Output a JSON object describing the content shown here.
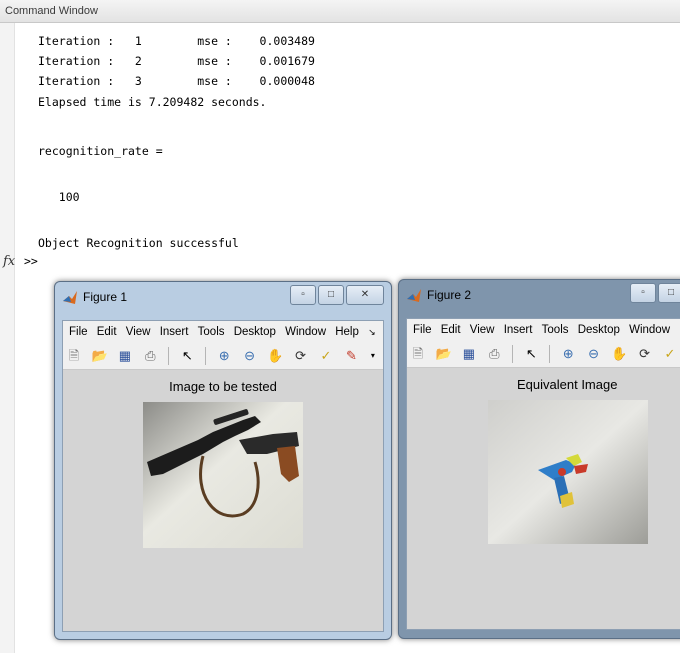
{
  "command_window": {
    "title": "Command Window",
    "lines": [
      "Iteration :   1        mse :    0.003489",
      "Iteration :   2        mse :    0.001679",
      "Iteration :   3        mse :    0.000048",
      "Elapsed time is 7.209482 seconds.",
      "recognition_rate =",
      "   100",
      "Object Recognition successful"
    ],
    "fx_label": "fx",
    "prompt": ">>"
  },
  "figure1": {
    "title": "Figure 1",
    "menu": [
      "File",
      "Edit",
      "View",
      "Insert",
      "Tools",
      "Desktop",
      "Window",
      "Help",
      "↘"
    ],
    "overflow": "»",
    "axes_title": "Image to be tested"
  },
  "figure2": {
    "title": "Figure 2",
    "menu": [
      "File",
      "Edit",
      "View",
      "Insert",
      "Tools",
      "Desktop",
      "Window"
    ],
    "axes_title": "Equivalent Image"
  },
  "toolbar_icons": [
    "new-file-icon",
    "open-folder-icon",
    "save-icon",
    "print-icon",
    "pointer-icon",
    "zoom-in-icon",
    "zoom-out-icon",
    "pan-hand-icon",
    "rotate-3d-icon",
    "data-cursor-icon",
    "brush-icon"
  ]
}
